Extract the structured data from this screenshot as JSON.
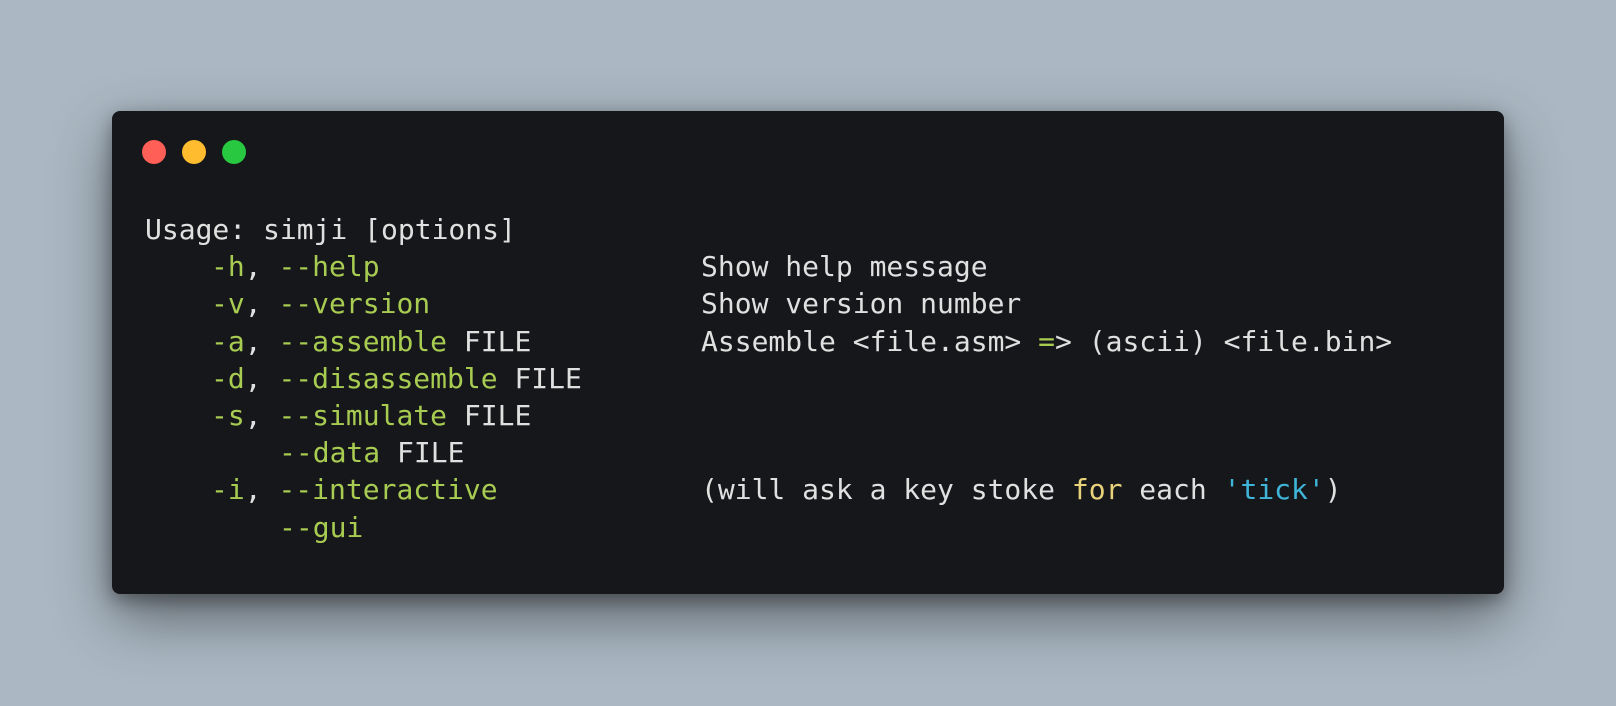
{
  "colors": {
    "background": "#abb8c3",
    "window": "#16171a",
    "text": "#e0e0e0",
    "option": "#a8cc52",
    "keyword": "#e8d27a",
    "string": "#3fb6d9",
    "dot_close": "#ff5f57",
    "dot_minimize": "#febc2e",
    "dot_maximize": "#28c840"
  },
  "window_controls": [
    "close-dot",
    "minimize-dot",
    "maximize-dot"
  ],
  "terminal": {
    "usage": "Usage: simji [options]",
    "options": [
      {
        "short": "-h",
        "sep": ", ",
        "long": "--help",
        "arg": "",
        "desc_parts": [
          {
            "t": "Show help message",
            "c": "text"
          }
        ]
      },
      {
        "short": "-v",
        "sep": ", ",
        "long": "--version",
        "arg": "",
        "desc_parts": [
          {
            "t": "Show version number",
            "c": "text"
          }
        ]
      },
      {
        "short": "-a",
        "sep": ", ",
        "long": "--assemble",
        "arg": " FILE",
        "desc_parts": [
          {
            "t": "Assemble <file.asm> ",
            "c": "text"
          },
          {
            "t": "=",
            "c": "option"
          },
          {
            "t": "> (ascii) <file.bin>",
            "c": "text"
          }
        ]
      },
      {
        "short": "-d",
        "sep": ", ",
        "long": "--disassemble",
        "arg": " FILE",
        "desc_parts": []
      },
      {
        "short": "-s",
        "sep": ", ",
        "long": "--simulate",
        "arg": " FILE",
        "desc_parts": []
      },
      {
        "short": "",
        "sep": "",
        "long": "--data",
        "arg": " FILE",
        "desc_parts": []
      },
      {
        "short": "-i",
        "sep": ", ",
        "long": "--interactive",
        "arg": "",
        "desc_parts": [
          {
            "t": "(will ask a key stoke ",
            "c": "text"
          },
          {
            "t": "for",
            "c": "keyword"
          },
          {
            "t": " each ",
            "c": "text"
          },
          {
            "t": "'tick'",
            "c": "string"
          },
          {
            "t": ")",
            "c": "text"
          }
        ]
      },
      {
        "short": "",
        "sep": "",
        "long": "--gui",
        "arg": "",
        "desc_parts": []
      }
    ]
  }
}
